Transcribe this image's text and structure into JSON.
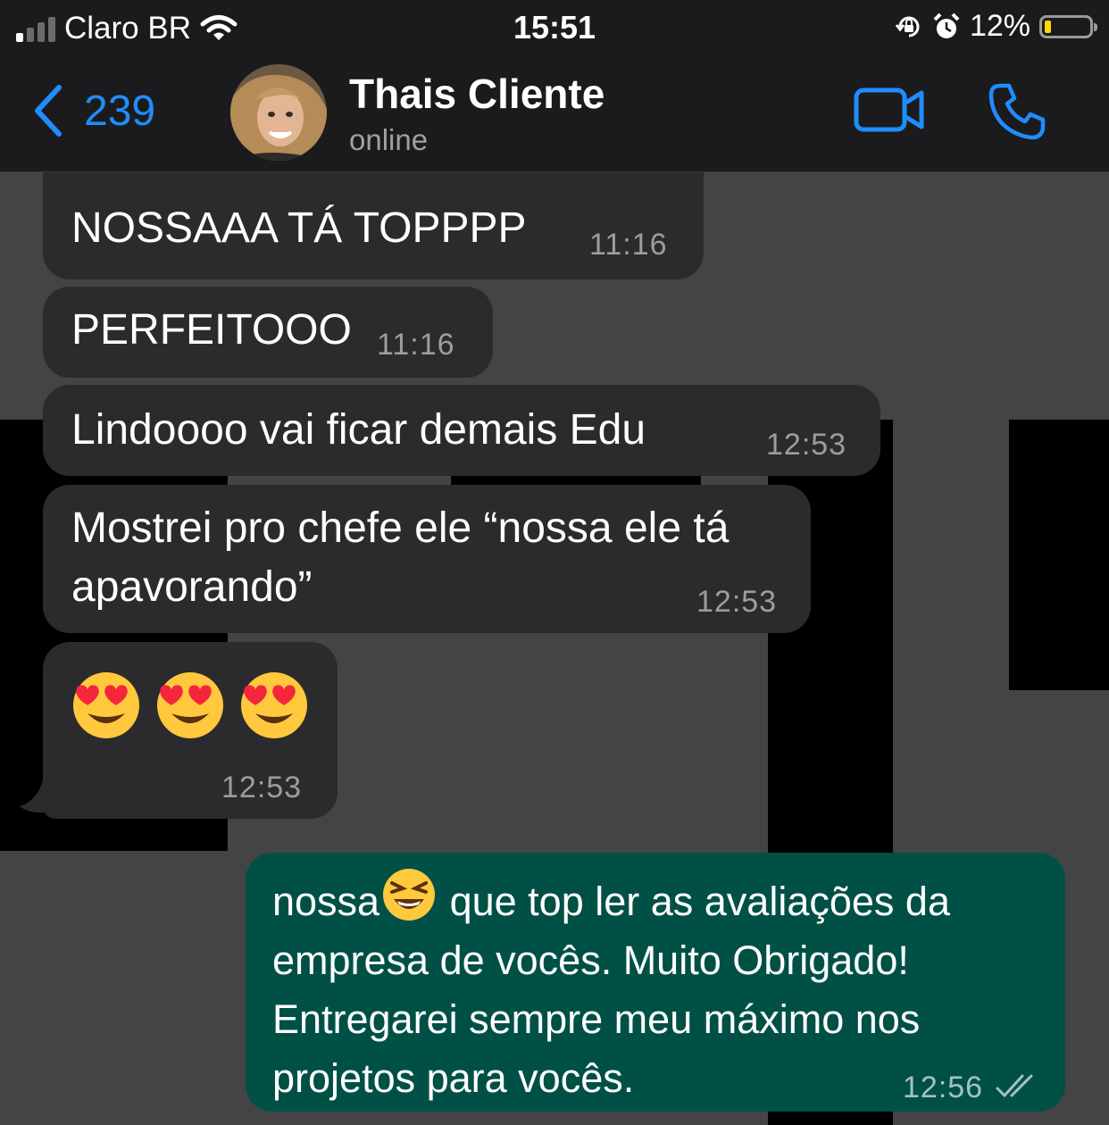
{
  "status_bar": {
    "carrier": "Claro BR",
    "time": "15:51",
    "battery_percent": "12%",
    "battery_level": 0.12,
    "icons": [
      "signal-icon",
      "wifi-icon",
      "rotation-lock-icon",
      "alarm-icon",
      "battery-icon"
    ]
  },
  "header": {
    "back_count": "239",
    "contact_name": "Thais Cliente",
    "contact_status": "online"
  },
  "messages": [
    {
      "direction": "incoming",
      "text": "NOSSAAA TÁ TOPPPP",
      "time": "11:16"
    },
    {
      "direction": "incoming",
      "text": "PERFEITOOO",
      "time": "11:16"
    },
    {
      "direction": "incoming",
      "text": "Lindoooo vai ficar demais Edu",
      "time": "12:53"
    },
    {
      "direction": "incoming",
      "text": "Mostrei pro chefe ele “nossa ele tá apavorando”",
      "time": "12:53"
    },
    {
      "direction": "incoming",
      "text": "😍😍😍",
      "time": "12:53"
    },
    {
      "direction": "outgoing",
      "text_before": "nossa",
      "text_after": " que top ler as avaliações da empresa de vocês. Muito Obrigado! Entregarei sempre meu máximo nos projetos para vocês.",
      "time": "12:56",
      "status": "read"
    }
  ],
  "colors": {
    "accent": "#1f8dfc",
    "incoming_bubble": "#2b2b2d",
    "outgoing_bubble": "#005046",
    "header_bg": "#1b1b1d"
  }
}
